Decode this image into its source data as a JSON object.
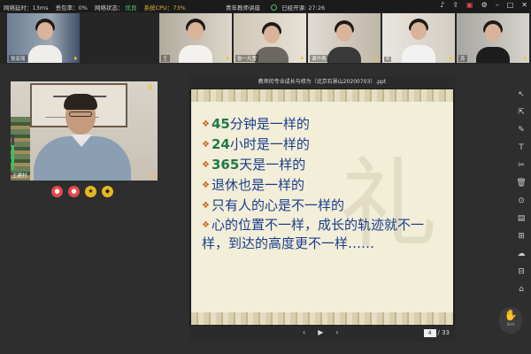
{
  "topbar": {
    "latency": "网络延时：13ms",
    "loss": "丢包率：0%",
    "net_status_label": "网络状态：",
    "net_status_value": "优良",
    "cpu": "系统CPU：73%",
    "title": "青年教师讲座",
    "elapsed": "已经开课: 27:26"
  },
  "thumbnails": [
    {
      "name": "张宏丽"
    },
    {
      "name": "王"
    },
    {
      "name": "张一凡雪"
    },
    {
      "name": "谭开燕"
    },
    {
      "name": "X"
    },
    {
      "name": "苏"
    }
  ],
  "speaker": {
    "name": "王建村",
    "mic_label": "x0"
  },
  "presentation": {
    "title": "教师的专业成长与修为（北京石景山20200703）.ppt",
    "bullets": [
      {
        "num": "45",
        "text": "分钟是一样的"
      },
      {
        "num": "24",
        "text": "小时是一样的"
      },
      {
        "num": "365",
        "text": "天是一样的"
      },
      {
        "num": "",
        "text": "退休也是一样的"
      },
      {
        "num": "",
        "text": "只有人的心是不一样的"
      },
      {
        "num": "",
        "text": "心的位置不一样，成长的轨迹就不一样，到达的高度更不一样……"
      }
    ],
    "current_page": "4",
    "total_pages": "/ 33"
  },
  "hand_label": "SHA",
  "colors": {
    "bullet_text": "#1a3e8c",
    "number": "#1f7a4a",
    "diamond": "#c9662a",
    "good": "#4fd06a",
    "cpu": "#e8b23a"
  }
}
